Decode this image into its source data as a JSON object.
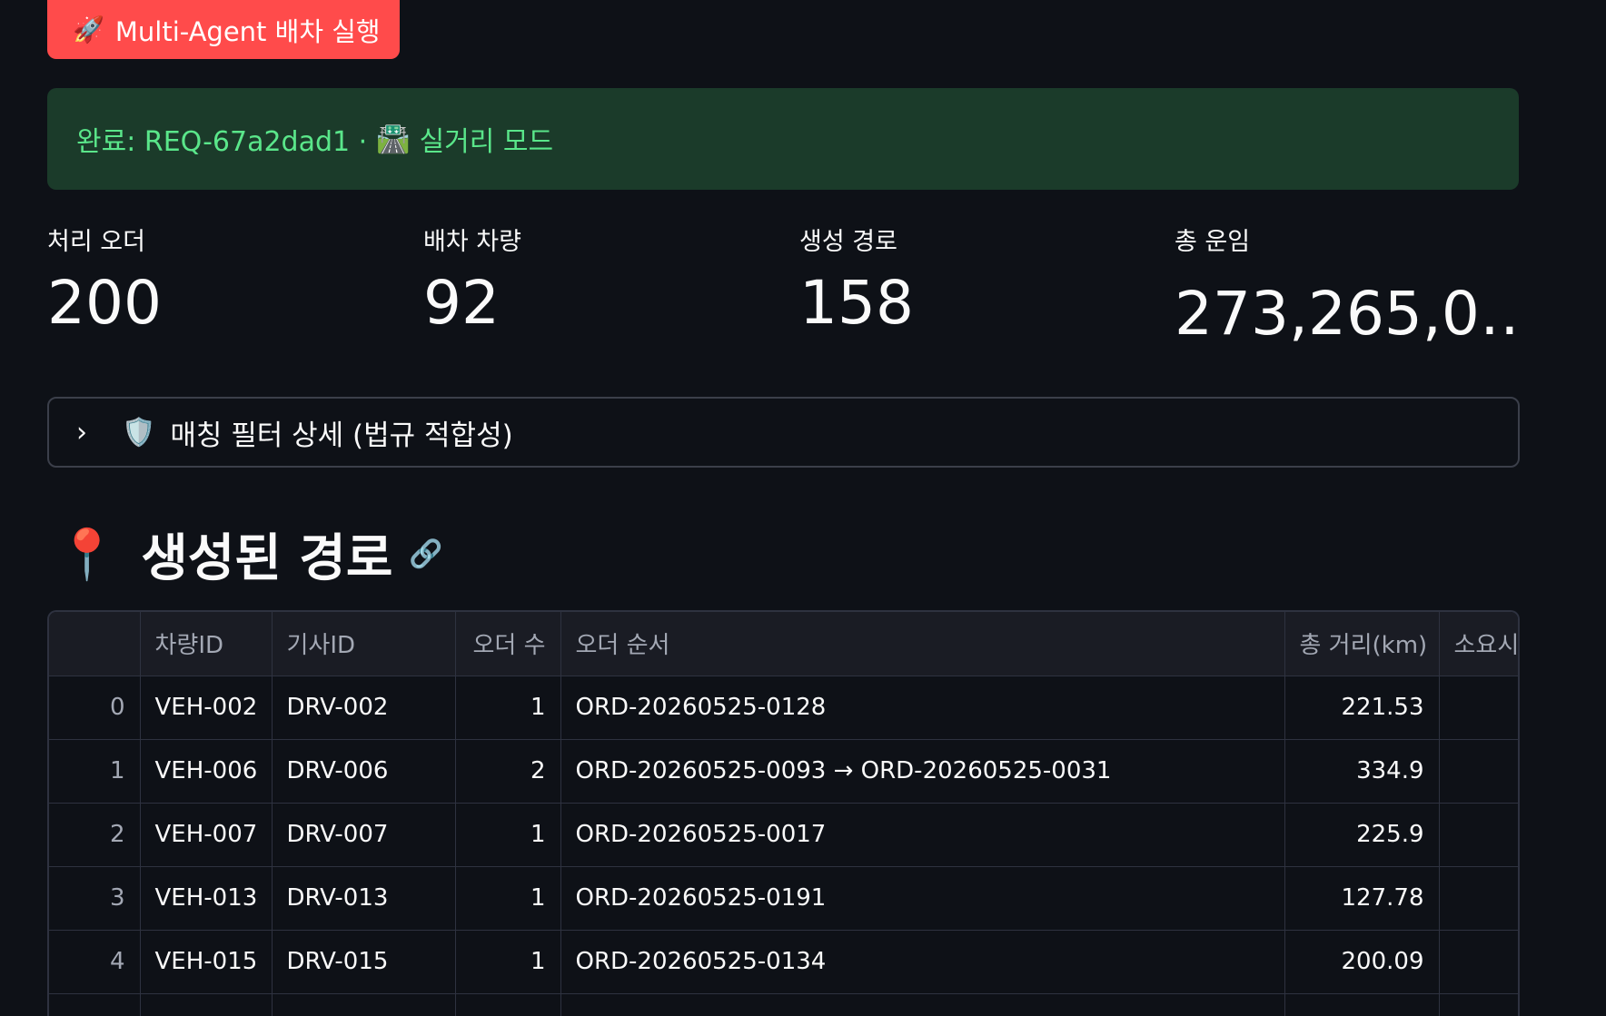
{
  "run_button": {
    "icon": "rocket-icon",
    "label": "Multi-Agent 배차 실행"
  },
  "status": {
    "text": "완료: REQ-67a2dad1 ·",
    "mode_icon": "road-icon",
    "mode": "실거리 모드"
  },
  "metrics": [
    {
      "label": "처리 오더",
      "value": "200"
    },
    {
      "label": "배차 차량",
      "value": "92"
    },
    {
      "label": "생성 경로",
      "value": "158"
    },
    {
      "label": "총 운임",
      "value": "273,265,0…"
    }
  ],
  "expander": {
    "chevron_icon": "chevron-right-icon",
    "shield_icon": "shield-icon",
    "label": "매칭 필터 상세 (법규 적합성)"
  },
  "section": {
    "pin_icon": "pin-icon",
    "title": "생성된 경로",
    "link_icon": "link-icon"
  },
  "table": {
    "columns": [
      "",
      "차량ID",
      "기사ID",
      "오더 수",
      "오더 순서",
      "총 거리(km)",
      "소요시"
    ],
    "rows": [
      {
        "idx": "0",
        "vehicle": "VEH-002",
        "driver": "DRV-002",
        "count": "1",
        "order": "ORD-20260525-0128",
        "distance": "221.53"
      },
      {
        "idx": "1",
        "vehicle": "VEH-006",
        "driver": "DRV-006",
        "count": "2",
        "order": "ORD-20260525-0093 → ORD-20260525-0031",
        "distance": "334.9"
      },
      {
        "idx": "2",
        "vehicle": "VEH-007",
        "driver": "DRV-007",
        "count": "1",
        "order": "ORD-20260525-0017",
        "distance": "225.9"
      },
      {
        "idx": "3",
        "vehicle": "VEH-013",
        "driver": "DRV-013",
        "count": "1",
        "order": "ORD-20260525-0191",
        "distance": "127.78"
      },
      {
        "idx": "4",
        "vehicle": "VEH-015",
        "driver": "DRV-015",
        "count": "1",
        "order": "ORD-20260525-0134",
        "distance": "200.09"
      }
    ]
  }
}
